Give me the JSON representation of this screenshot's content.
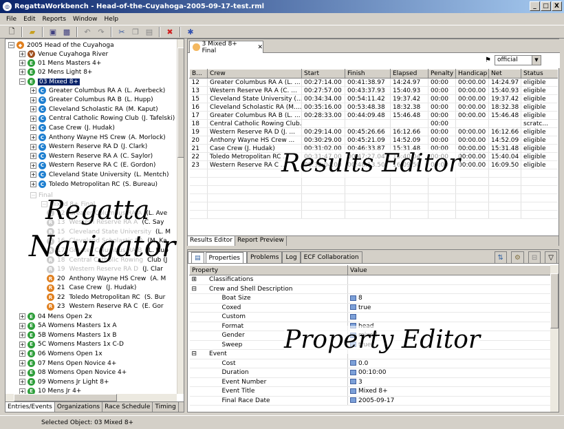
{
  "window": {
    "title": "RegattaWorkbench - Head-of-the-Cuyahoga-2005-09-17-test.rml",
    "controls": [
      "_",
      "□",
      "X"
    ]
  },
  "menu": [
    "File",
    "Edit",
    "Reports",
    "Window",
    "Help"
  ],
  "navigator": {
    "overlay_line1": "Regatta",
    "overlay_line2": "Navigator",
    "root": "2005 Head of the Cuyahoga",
    "venue": "Venue Cuyahoga River",
    "events_top": [
      {
        "icon": "E",
        "label": "01  Mens Masters 4+"
      },
      {
        "icon": "E",
        "label": "02  Mens Light 8+"
      }
    ],
    "selected_event": "03  Mixed 8+",
    "crews": [
      {
        "name": "Greater Columbus RA A",
        "cox": "(L. Averbeck)"
      },
      {
        "name": "Greater Columbus RA B",
        "cox": "(L. Hupp)"
      },
      {
        "name": "Cleveland Scholastic RA",
        "cox": "(M. Kaput)"
      },
      {
        "name": "Central Catholic Rowing Club",
        "cox": "(J. Tafelski)"
      },
      {
        "name": "Case Crew",
        "cox": "(J. Hudak)"
      },
      {
        "name": "Anthony Wayne HS Crew",
        "cox": "(A. Morlock)"
      },
      {
        "name": "Western Reserve RA D",
        "cox": "(J. Clark)"
      },
      {
        "name": "Western Reserve RA A",
        "cox": "(C. Saylor)"
      },
      {
        "name": "Western Reserve RA C",
        "cox": "(E. Gordon)"
      },
      {
        "name": "Cleveland State University",
        "cox": "(L. Mentch)"
      },
      {
        "name": "Toledo Metropolitan RC",
        "cox": "(S. Bureau)"
      }
    ],
    "final_label": "Final",
    "final_event": "Mixed 8+ Final",
    "faded_results": [
      {
        "num": "12",
        "name": "Greater Columbus RA A",
        "cox": "(L. Ave"
      },
      {
        "num": "13",
        "name": "Western Reserve RA A",
        "cox": "(C. Say"
      },
      {
        "num": "15",
        "name": "Cleveland State University",
        "cox": "(L. M"
      },
      {
        "num": "16",
        "name": "Cleveland Scholastic RA",
        "cox": "(M. Ka"
      },
      {
        "num": "17",
        "name": "Greater Columbus RA B",
        "cox": "(L. Hup"
      },
      {
        "num": "18",
        "name": "Central Catholic Rowing",
        "cox": "Club (J"
      },
      {
        "num": "19",
        "name": "Western Reserve RA D",
        "cox": "(J. Clar"
      }
    ],
    "results": [
      {
        "num": "20",
        "name": "Anthony Wayne HS Crew",
        "cox": "(A. M"
      },
      {
        "num": "21",
        "name": "Case Crew",
        "cox": "(J. Hudak)"
      },
      {
        "num": "22",
        "name": "Toledo Metropolitan RC",
        "cox": "(S. Bur"
      },
      {
        "num": "23",
        "name": "Western Reserve RA C",
        "cox": "(E. Gor"
      }
    ],
    "events_bottom": [
      {
        "icon": "E",
        "label": "04  Mens Open 2x"
      },
      {
        "icon": "E",
        "label": "5A  Womens Masters 1x A"
      },
      {
        "icon": "E",
        "label": "5B  Womens Masters 1x B"
      },
      {
        "icon": "E",
        "label": "5C  Womens Masters 1x C-D"
      },
      {
        "icon": "E",
        "label": "06  Womens Open 1x"
      },
      {
        "icon": "E",
        "label": "07  Mens Open Novice 4+"
      },
      {
        "icon": "E",
        "label": "08  Womens Open Novice 4+"
      },
      {
        "icon": "E",
        "label": "09  Womens Jr Light 8+"
      },
      {
        "icon": "E",
        "label": "10  Mens Jr 4+"
      }
    ],
    "tabs": [
      "Entries/Events",
      "Organizations",
      "Race Schedule",
      "Timing"
    ]
  },
  "results_editor": {
    "overlay": "Results Editor",
    "tab_label": "3  Mixed 8+ Final",
    "status_combo": "official",
    "columns": [
      "B...",
      "Crew",
      "Start",
      "Finish",
      "Elapsed",
      "Penalty",
      "Handicap",
      "Net",
      "Status"
    ],
    "rows": [
      [
        "12",
        "Greater Columbus RA A  (L. ...",
        "00:27:14.00",
        "00:41:38.97",
        "14:24.97",
        "00:00",
        "00:00.00",
        "14:24.97",
        "eligible"
      ],
      [
        "13",
        "Western Reserve RA A  (C. ...",
        "00:27:57.00",
        "00:43:37.93",
        "15:40.93",
        "00:00",
        "00:00.00",
        "15:40.93",
        "eligible"
      ],
      [
        "15",
        "Cleveland State University  (...",
        "00:34:34.00",
        "00:54:11.42",
        "19:37.42",
        "00:00",
        "00:00.00",
        "19:37.42",
        "eligible"
      ],
      [
        "16",
        "Cleveland Scholastic RA  (M....",
        "00:35:16.00",
        "00:53:48.38",
        "18:32.38",
        "00:00",
        "00:00.00",
        "18:32.38",
        "eligible"
      ],
      [
        "17",
        "Greater Columbus RA B  (L. ...",
        "00:28:33.00",
        "00:44:09.48",
        "15:46.48",
        "00:00",
        "00:00.00",
        "15:46.48",
        "eligible"
      ],
      [
        "18",
        "Central Catholic Rowing Club...",
        "",
        "",
        "",
        "00:00",
        "",
        "",
        "scratc..."
      ],
      [
        "19",
        "Western Reserve RA D  (J. ...",
        "00:29:14.00",
        "00:45:26.66",
        "16:12.66",
        "00:00",
        "00:00.00",
        "16:12.66",
        "eligible"
      ],
      [
        "20",
        "Anthony Wayne HS Crew  ...",
        "00:30:29.00",
        "00:45:21.09",
        "14:52.09",
        "00:00",
        "00:00.00",
        "14:52.09",
        "eligible"
      ],
      [
        "21",
        "Case Crew  (J. Hudak)",
        "00:31:02.00",
        "00:46:33.87",
        "15:31.48",
        "00:00",
        "00:00.00",
        "15:31.48",
        "eligible"
      ],
      [
        "22",
        "Toledo Metropolitan RC  ...",
        "00:31:47.00",
        "00:47:27.04",
        "15:40.04",
        "00:00",
        "00:00.00",
        "15:40.04",
        "eligible"
      ],
      [
        "23",
        "Western Reserve RA C  ...",
        "00:32:04.00",
        "00:48:13.50",
        "16:09.50",
        "00:00",
        "00:00.00",
        "16:09.50",
        "eligible"
      ]
    ],
    "bottom_tabs": [
      "Results Editor",
      "Report Preview"
    ]
  },
  "property_editor": {
    "overlay": "Property Editor",
    "tabs": [
      "Properties",
      "Problems",
      "Log",
      "ECF Collaboration"
    ],
    "columns": [
      "Property",
      "Value"
    ],
    "rows": [
      {
        "level": 0,
        "exp": "+",
        "name": "Classifications",
        "value": ""
      },
      {
        "level": 0,
        "exp": "-",
        "name": "Crew and Shell Description",
        "value": ""
      },
      {
        "level": 1,
        "exp": "",
        "name": "Boat Size",
        "value": "8"
      },
      {
        "level": 1,
        "exp": "",
        "name": "Coxed",
        "value": "true"
      },
      {
        "level": 1,
        "exp": "",
        "name": "Custom",
        "value": ""
      },
      {
        "level": 1,
        "exp": "",
        "name": "Format",
        "value": "head"
      },
      {
        "level": 1,
        "exp": "",
        "name": "Gender",
        "value": "mixed"
      },
      {
        "level": 1,
        "exp": "",
        "name": "Sweep",
        "value": "true"
      },
      {
        "level": 0,
        "exp": "-",
        "name": "Event",
        "value": ""
      },
      {
        "level": 1,
        "exp": "",
        "name": "Cost",
        "value": "0.0"
      },
      {
        "level": 1,
        "exp": "",
        "name": "Duration",
        "value": "00:10:00"
      },
      {
        "level": 1,
        "exp": "",
        "name": "Event Number",
        "value": "3"
      },
      {
        "level": 1,
        "exp": "",
        "name": "Event Title",
        "value": "Mixed 8+"
      },
      {
        "level": 1,
        "exp": "",
        "name": "Final Race Date",
        "value": "2005-09-17"
      }
    ]
  },
  "statusbar": {
    "text": "Selected Object: 03  Mixed 8+"
  }
}
